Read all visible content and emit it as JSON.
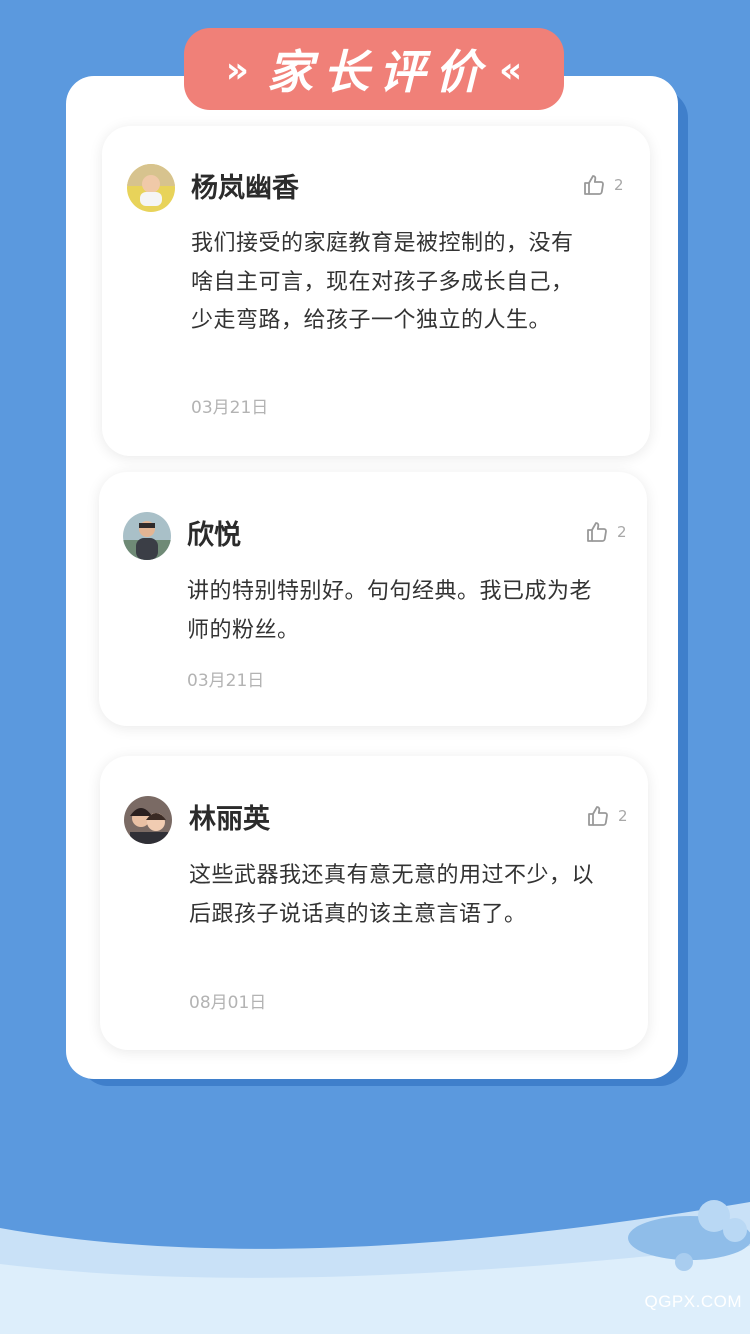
{
  "header": {
    "title": "家长评价",
    "left_chevron": "»",
    "right_chevron": "«"
  },
  "reviews": [
    {
      "name": "杨岚幽香",
      "likes": "2",
      "text": "我们接受的家庭教育是被控制的，没有啥自主可言，现在对孩子多成长自己，少走弯路，给孩子一个独立的人生。",
      "date": "03月21日"
    },
    {
      "name": "欣悦",
      "likes": "2",
      "text": "讲的特别特别好。句句经典。我已成为老师的粉丝。",
      "date": "03月21日"
    },
    {
      "name": "林丽英",
      "likes": "2",
      "text": "这些武器我还真有意无意的用过不少，以后跟孩子说话真的该主意言语了。",
      "date": "08月01日"
    }
  ],
  "watermark": "QGPX.COM",
  "colors": {
    "background": "#5b99de",
    "banner": "#f08078",
    "card": "#ffffff"
  },
  "icons": {
    "like": "thumbs-up-icon"
  }
}
